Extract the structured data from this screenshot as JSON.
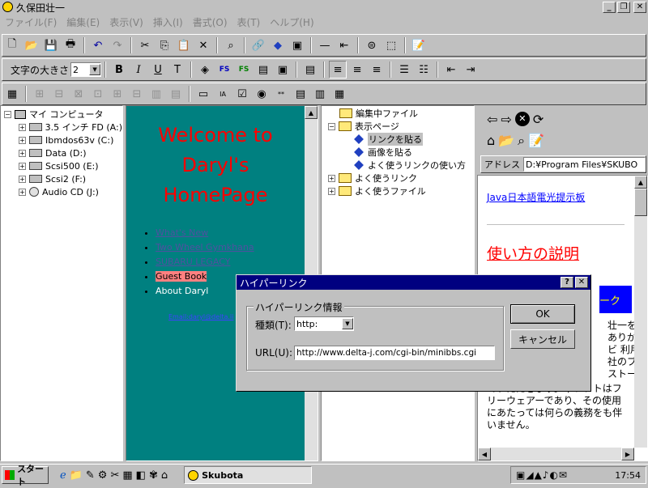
{
  "window": {
    "title": "久保田壮一"
  },
  "menu": [
    "ファイル(F)",
    "編集(E)",
    "表示(V)",
    "挿入(I)",
    "書式(O)",
    "表(T)",
    "ヘルプ(H)"
  ],
  "format": {
    "font_size_label": "文字の大きさ",
    "font_size_value": "2"
  },
  "tree": {
    "root": "マイ コンピュータ",
    "drives": [
      "3.5 インチ FD (A:)",
      "Ibmdos63v (C:)",
      "Data (D:)",
      "Scsi500 (E:)",
      "Scsi2 (F:)",
      "Audio CD (J:)"
    ]
  },
  "preview": {
    "heading": "Welcome to Daryl's HomePage",
    "links": [
      "What's New",
      "Two Wheel Gymkhana",
      "SUBARU LEGACY",
      "Guest Book",
      "About Daryl"
    ],
    "email": "Email:daryl@delta.ii"
  },
  "files": {
    "items": [
      "編集中ファイル",
      "表示ページ",
      "リンクを貼る",
      "画像を貼る",
      "よく使うリンクの使い方",
      "よく使うリンク",
      "よく使うファイル"
    ]
  },
  "browser": {
    "address_label": "アドレス",
    "address_value": "D:¥Program Files¥SKUBO",
    "link": "Java日本語電光提示板",
    "heading": "使い方の説明",
    "text_frag1": "ーク",
    "text_frag2": "壮一を",
    "text_frag3": "ありがと",
    "text_frag4": "ビ 利用",
    "text_frag5": "社のブ",
    "text_frag6": "ストー",
    "body": "ていただきます。本ソフトはフリーウェアーであり、その使用にあたっては何らの義務をも伴いません。"
  },
  "dialog": {
    "title": "ハイパーリンク",
    "group": "ハイパーリンク情報",
    "type_label": "種類(T):",
    "type_value": "http:",
    "url_label": "URL(U):",
    "url_value": "http://www.delta-j.com/cgi-bin/minibbs.cgi",
    "ok": "OK",
    "cancel": "キャンセル",
    "help": "?",
    "close": "✕"
  },
  "taskbar": {
    "start": "スタート",
    "task": "Skubota",
    "clock": "17:54"
  }
}
